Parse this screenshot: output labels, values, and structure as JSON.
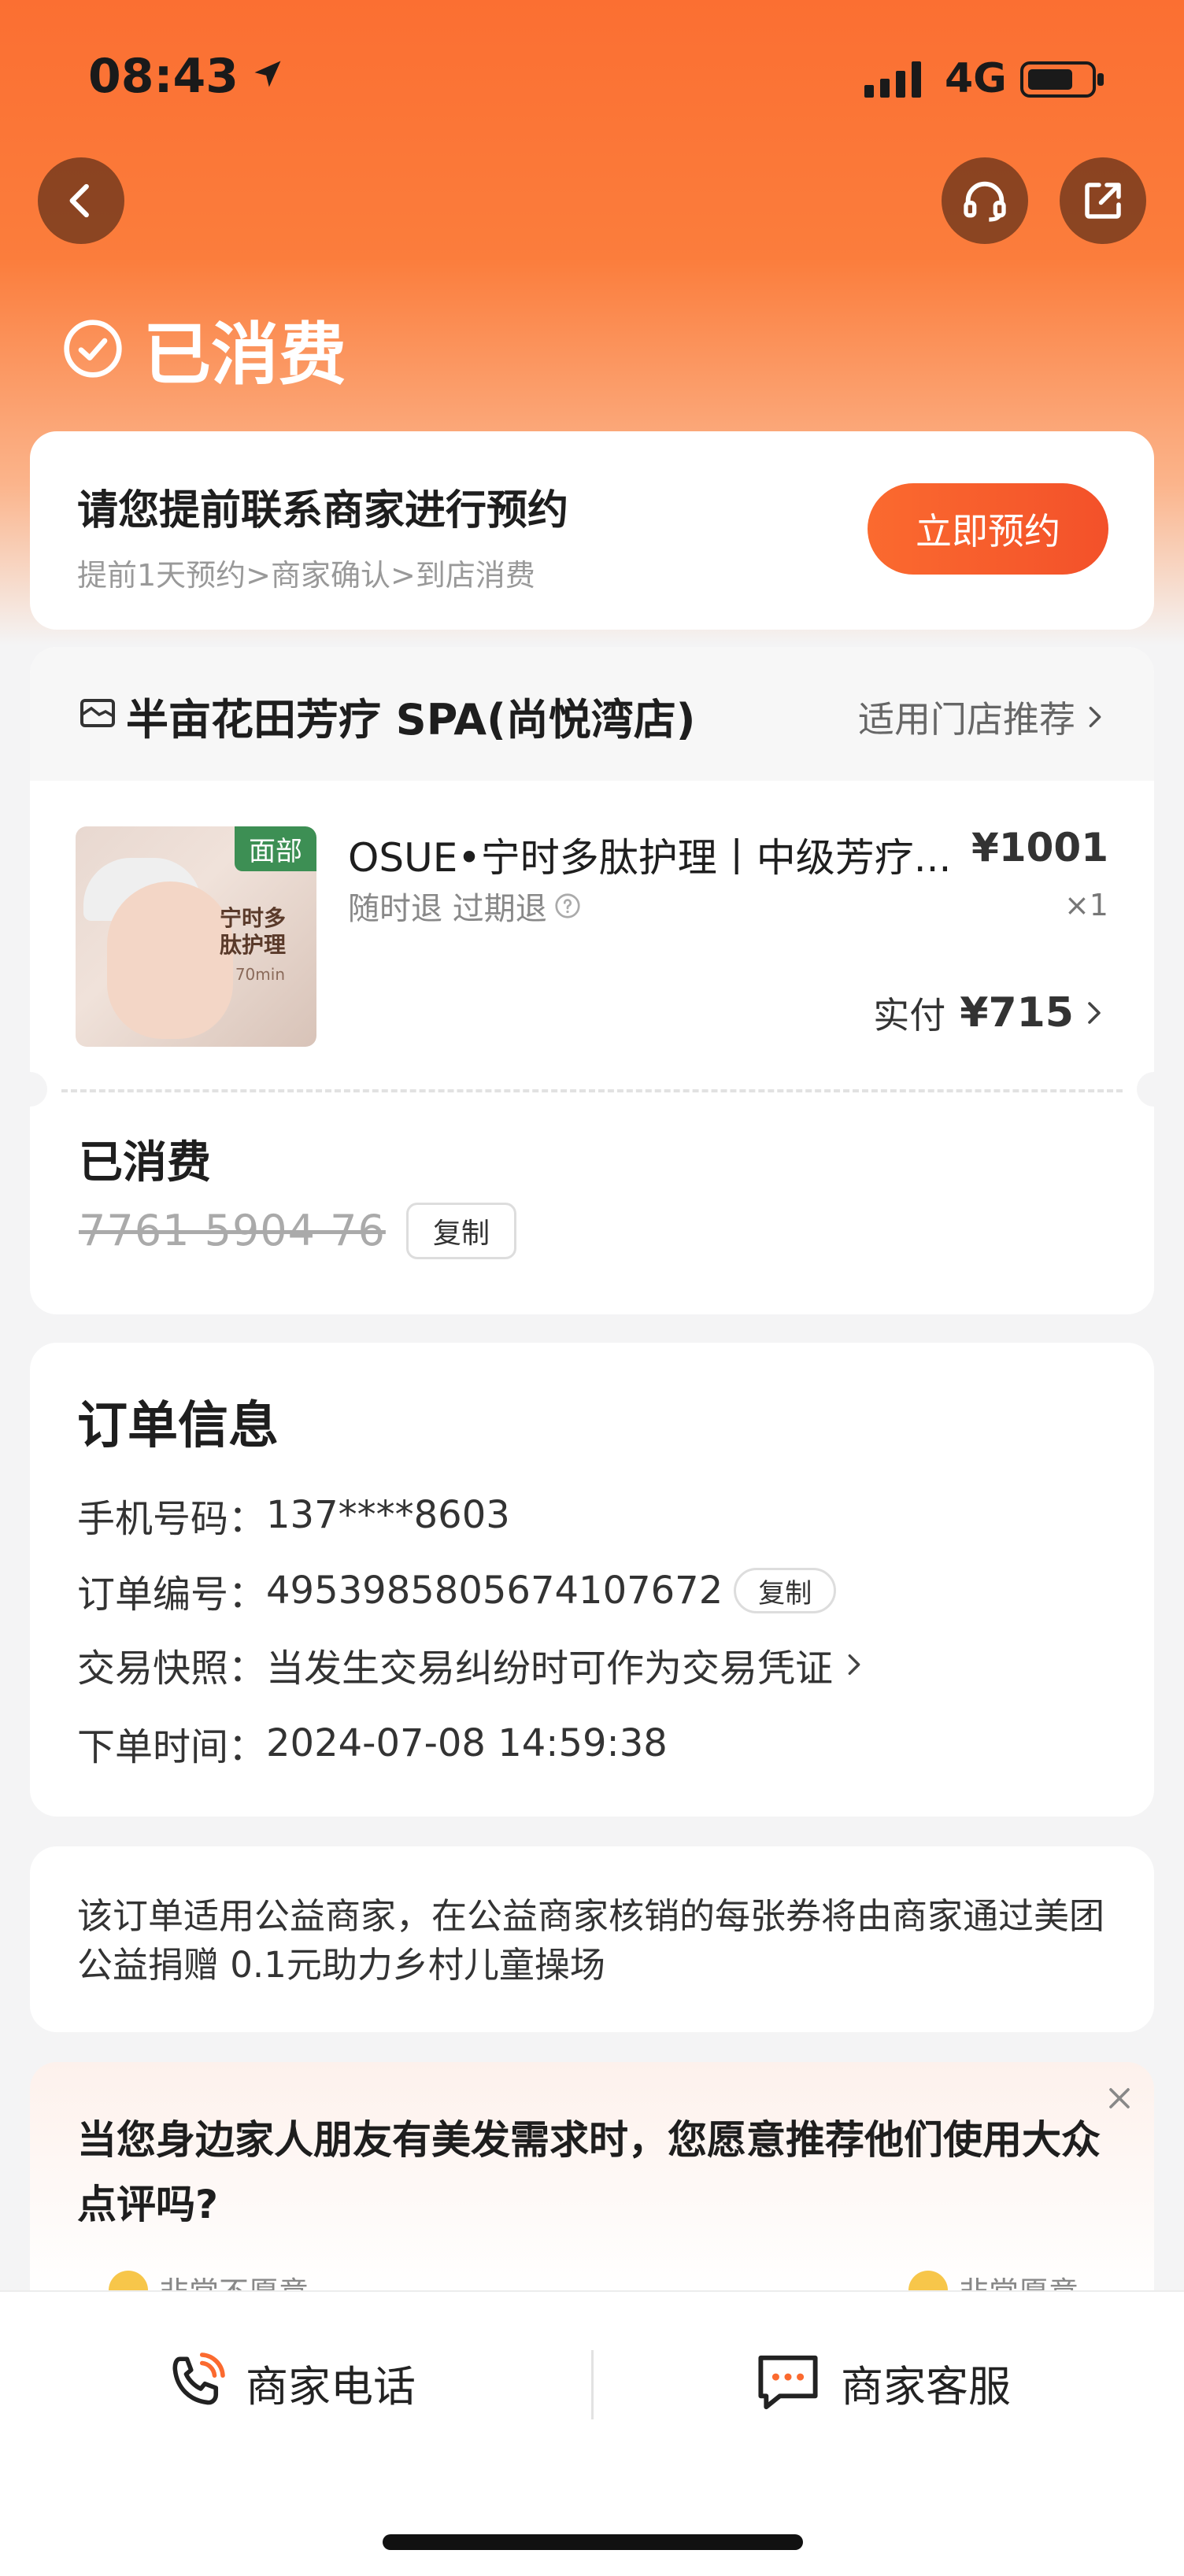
{
  "status_bar": {
    "time": "08:43",
    "network": "4G"
  },
  "header": {
    "status_title": "已消费",
    "icons": {
      "back": "chevron-left-icon",
      "service": "headset-icon",
      "share": "share-icon"
    }
  },
  "booking": {
    "title": "请您提前联系商家进行预约",
    "subtitle": "提前1天预约>商家确认>到店消费",
    "button_label": "立即预约"
  },
  "store": {
    "name": "半亩花田芳疗 SPA(尚悦湾店)",
    "link_label": "适用门店推荐"
  },
  "product": {
    "badge": "面部",
    "thumb_caption": "宁时多肽护理",
    "thumb_small": "70min",
    "title": "OSUE•宁时多肽护理丨中级芳疗...",
    "price": "¥1001",
    "tags": "随时退 过期退",
    "qty": "×1",
    "paid_label": "实付",
    "paid_amount": "¥715"
  },
  "voucher": {
    "label": "已消费",
    "code": "7761 5904 76",
    "copy_label": "复制"
  },
  "order": {
    "title": "订单信息",
    "phone_label": "手机号码：",
    "phone_value": "137****8603",
    "orderno_label": "订单编号：",
    "orderno_value": "4953985805674107672",
    "copy_label": "复制",
    "snapshot_label": "交易快照：",
    "snapshot_value": "当发生交易纠纷时可作为交易凭证",
    "time_label": "下单时间：",
    "time_value": "2024-07-08 14:59:38"
  },
  "charity": {
    "text": "该订单适用公益商家，在公益商家核销的每张券将由商家通过美团公益捐赠 0.1元助力乡村儿童操场"
  },
  "survey": {
    "question": "当您身边家人朋友有美发需求时，您愿意推荐他们使用大众点评吗?",
    "option_left": "非常不愿意",
    "option_right": "非常愿意"
  },
  "bottom_bar": {
    "phone_label": "商家电话",
    "chat_label": "商家客服"
  },
  "colors": {
    "accent": "#fb6a2f",
    "background": "#f4f4f5"
  }
}
